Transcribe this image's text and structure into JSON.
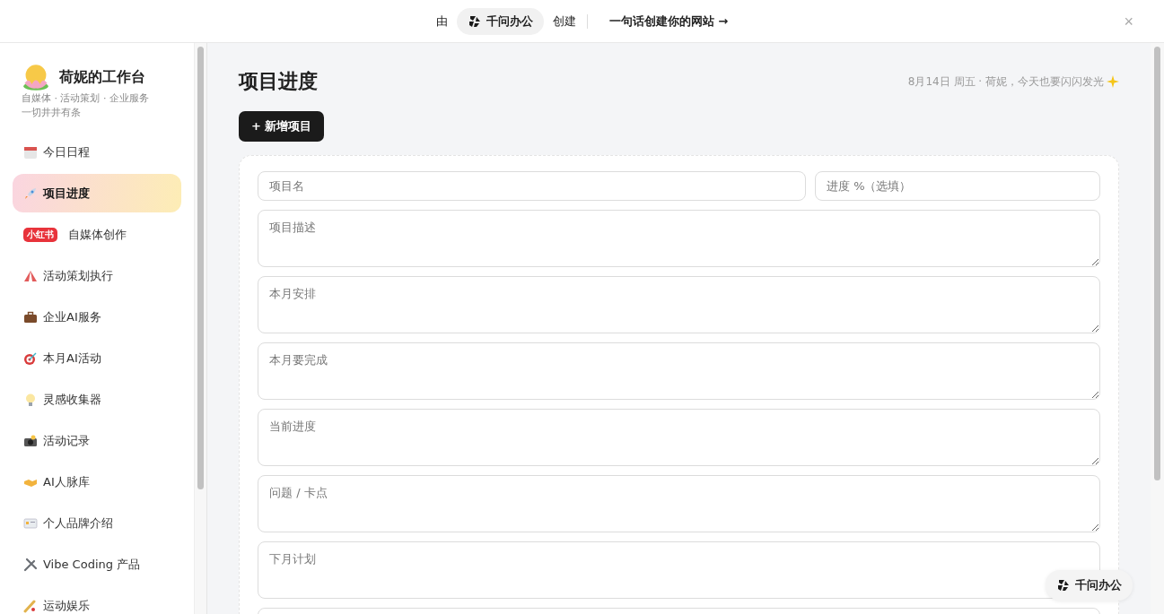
{
  "banner": {
    "prefix": "由",
    "brand": "千问办公",
    "suffix": "创建",
    "link": "一句话创建你的网站 →",
    "close": "×"
  },
  "sidebar": {
    "title": "荷妮的工作台",
    "subtitle": "自媒体 · 活动策划 · 企业服务",
    "tagline": "一切井井有条",
    "items": [
      {
        "kind": "calendar",
        "label": "今日日程",
        "selected": false
      },
      {
        "kind": "rocket",
        "label": "项目进度",
        "selected": true
      },
      {
        "kind": "badge",
        "badge": "小红书",
        "label": "自媒体创作",
        "selected": false
      },
      {
        "kind": "tent",
        "label": "活动策划执行",
        "selected": false
      },
      {
        "kind": "briefcase",
        "label": "企业AI服务",
        "selected": false
      },
      {
        "kind": "target",
        "label": "本月AI活动",
        "selected": false
      },
      {
        "kind": "bulb",
        "label": "灵感收集器",
        "selected": false
      },
      {
        "kind": "camera",
        "label": "活动记录",
        "selected": false
      },
      {
        "kind": "handshake",
        "label": "AI人脉库",
        "selected": false
      },
      {
        "kind": "card",
        "label": "个人品牌介绍",
        "selected": false
      },
      {
        "kind": "tools",
        "label": "Vibe Coding 产品",
        "selected": false
      },
      {
        "kind": "bat",
        "label": "运动娱乐",
        "selected": false
      }
    ]
  },
  "main": {
    "title": "项目进度",
    "greeting": "8月14日 周五 · 荷妮，今天也要闪闪发光",
    "add_button": "+ 新增项目",
    "form": {
      "name_placeholder": "项目名",
      "progress_placeholder": "进度 %（选填）",
      "textareas": [
        {
          "kind": "textarea",
          "placeholder": "项目描述"
        },
        {
          "kind": "textarea",
          "placeholder": "本月安排"
        },
        {
          "kind": "textarea",
          "placeholder": "本月要完成"
        },
        {
          "kind": "textarea",
          "placeholder": "当前进度"
        },
        {
          "kind": "textarea",
          "placeholder": "问题 / 卡点"
        },
        {
          "kind": "textarea",
          "placeholder": "下月计划"
        },
        {
          "kind": "textarea"
        }
      ]
    }
  },
  "floating_badge": "千问办公"
}
